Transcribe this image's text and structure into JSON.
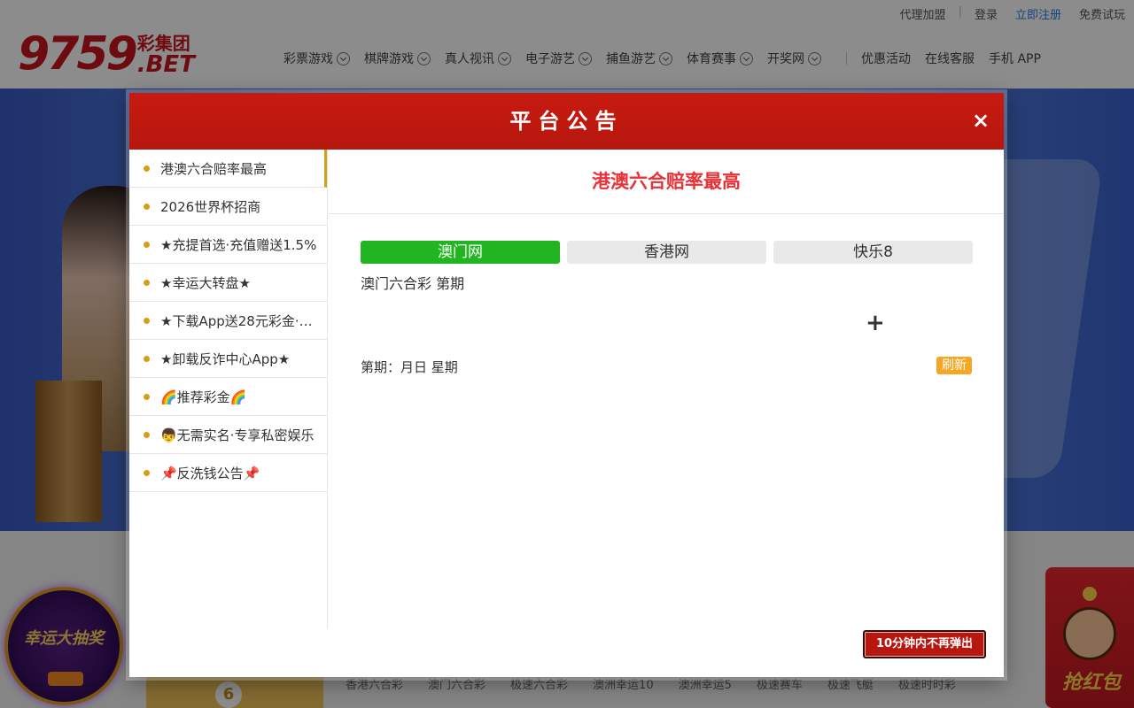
{
  "topbar": {
    "links": [
      "代理加盟",
      "登录",
      "立即注册",
      "免费试玩"
    ]
  },
  "logo": {
    "number": "9759",
    "group": "彩集团",
    "domain": ".BET"
  },
  "nav": {
    "dropdowns": [
      "彩票游戏",
      "棋牌游戏",
      "真人视讯",
      "电子游艺",
      "捕鱼游艺",
      "体育赛事",
      "开奖网"
    ],
    "links": [
      "优惠活动",
      "在线客服",
      "手机 APP"
    ]
  },
  "background": {
    "ball_number": "6",
    "games": [
      "香港六合彩",
      "澳门六合彩",
      "极速六合彩",
      "澳洲幸运10",
      "澳洲幸运5",
      "极速赛车",
      "极速飞艇",
      "极速时时彩"
    ],
    "lucky_draw": "幸运大抽奖",
    "red_packet": "抢红包"
  },
  "modal": {
    "title": "平台公告",
    "close": "×",
    "announcements": [
      "港澳六合赔率最高",
      "2026世界杯招商",
      "★充提首选·充值赠送1.5%",
      "★幸运大转盘★",
      "★下载App送28元彩金·…",
      "★卸载反诈中心App★",
      "🌈推荐彩金🌈",
      "👦无需实名·专享私密娱乐",
      "📌反洗钱公告📌"
    ],
    "active_index": 0,
    "content": {
      "title": "港澳六合赔率最高",
      "tabs": [
        "澳门网",
        "香港网",
        "快乐8"
      ],
      "active_tab": 0,
      "lottery_line": "澳门六合彩 第期",
      "plus": "+",
      "period_line": "第期：月日 星期",
      "refresh": "刷新"
    },
    "dismiss": "10分钟内不再弹出"
  },
  "colors": {
    "brand_red": "#c8141e",
    "header_red": "#c81a10",
    "accent_gold": "#d4a015",
    "tab_green": "#22b522",
    "refresh_orange": "#f5a623"
  }
}
